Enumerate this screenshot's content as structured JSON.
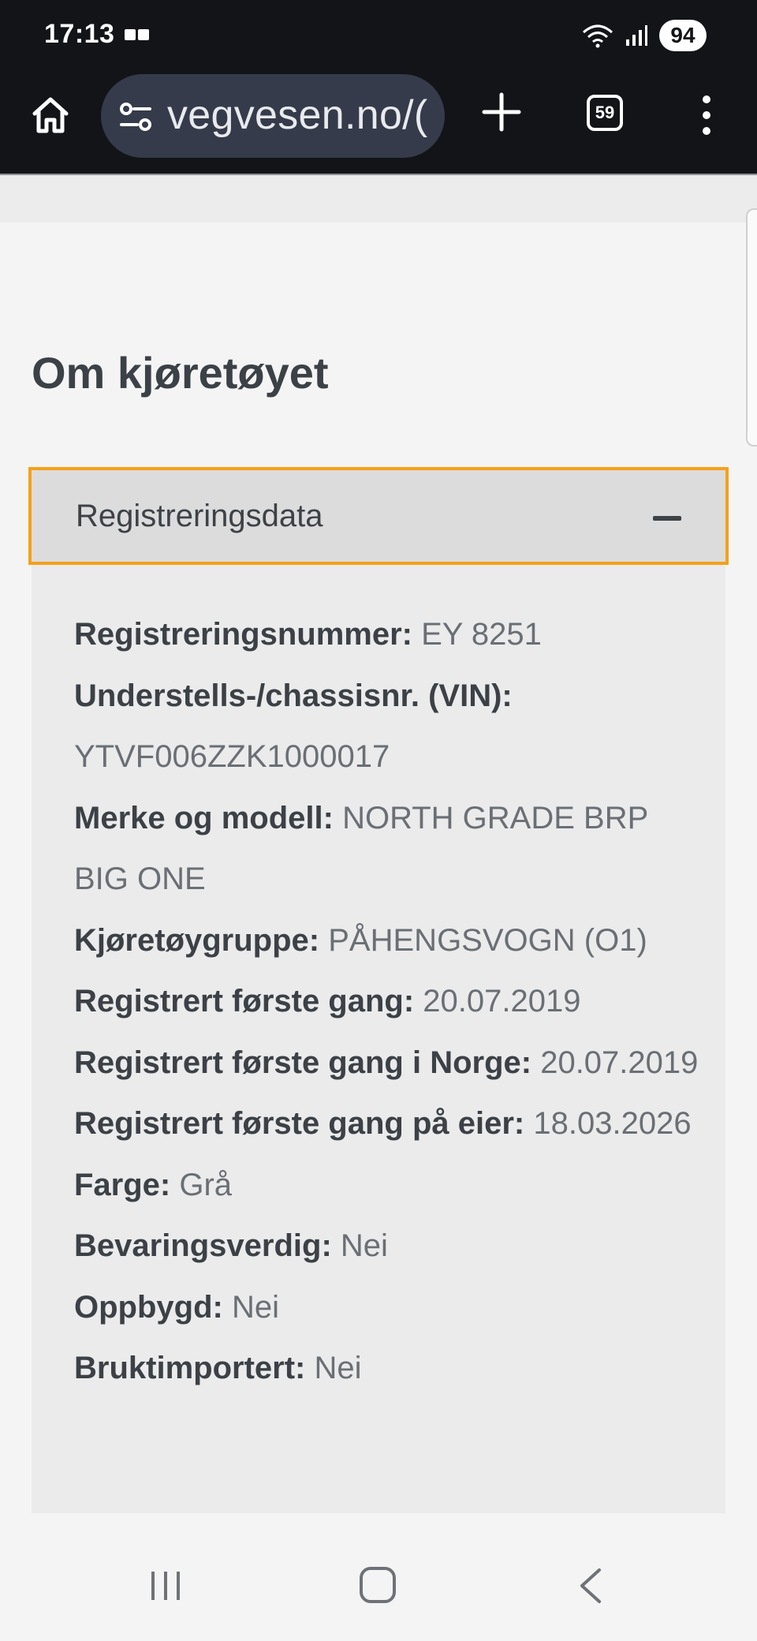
{
  "status_bar": {
    "time": "17:13",
    "battery": "94",
    "icons": [
      "notification-icon",
      "wifi-icon",
      "signal-icon"
    ]
  },
  "browser": {
    "url": "vegvesen.no/(",
    "tab_count": "59",
    "icons": [
      "home-icon",
      "site-settings-icon",
      "new-tab-icon",
      "tabs-icon",
      "overflow-menu-icon"
    ]
  },
  "page": {
    "title": "Om kjøretøyet",
    "accordion": {
      "title": "Registreringsdata",
      "expanded": true,
      "accent_color": "#f5a01a",
      "fields": [
        {
          "label": "Registreringsnummer:",
          "value": "EY 8251"
        },
        {
          "label": "Understells-/chassisnr. (VIN):",
          "value": "YTVF006ZZK1000017"
        },
        {
          "label": "Merke og modell:",
          "value": "NORTH GRADE BRP BIG ONE"
        },
        {
          "label": "Kjøretøygruppe:",
          "value": "PÅHENGSVOGN (O1)"
        },
        {
          "label": "Registrert første gang:",
          "value": "20.07.2019"
        },
        {
          "label": "Registrert første gang i Norge:",
          "value": "20.07.2019"
        },
        {
          "label": "Registrert første gang på eier:",
          "value": "18.03.2026"
        },
        {
          "label": "Farge:",
          "value": "Grå"
        },
        {
          "label": "Bevaringsverdig:",
          "value": "Nei"
        },
        {
          "label": "Oppbygd:",
          "value": "Nei"
        },
        {
          "label": "Bruktimportert:",
          "value": "Nei"
        }
      ]
    }
  },
  "nav_bar": {
    "icons": [
      "recents-icon",
      "home-nav-icon",
      "back-icon"
    ]
  }
}
